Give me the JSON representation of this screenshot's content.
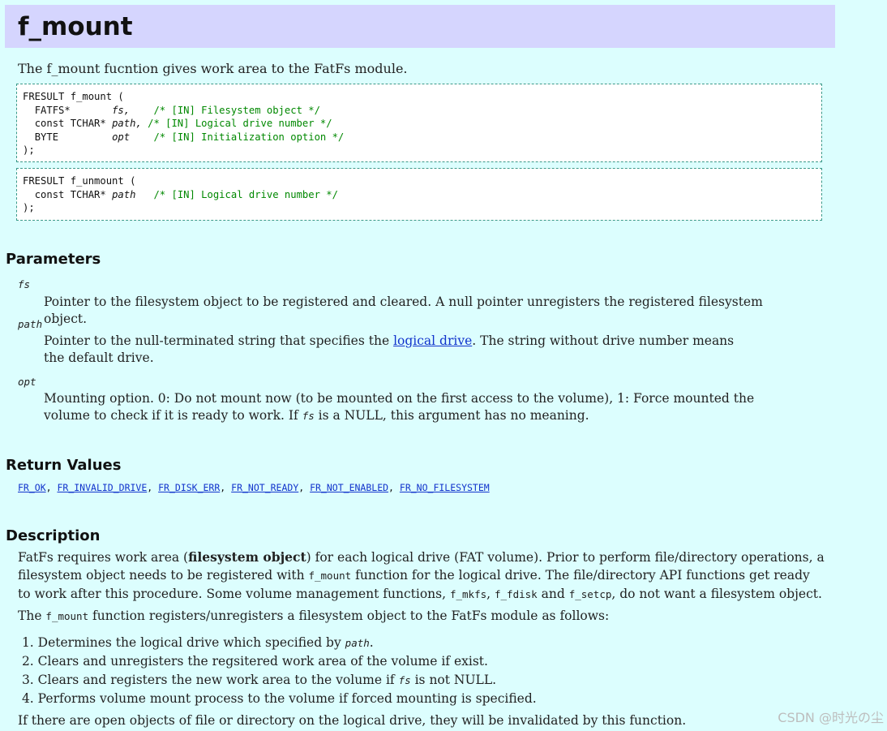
{
  "title": "f_mount",
  "abstract": "The f_mount fucntion gives work area to the FatFs module.",
  "prototype_mount": {
    "line1": "FRESULT f_mount (",
    "params": [
      {
        "type": "FATFS*      ",
        "name": "fs,   ",
        "comment": "/* [IN] Filesystem object */"
      },
      {
        "type": "const TCHAR*",
        "name": "path,",
        "comment": "/* [IN] Logical drive number */"
      },
      {
        "type": "BYTE        ",
        "name": "opt   ",
        "comment": "/* [IN] Initialization option */"
      }
    ],
    "close": ");"
  },
  "prototype_unmount": {
    "line1": "FRESULT f_unmount (",
    "params": [
      {
        "type": "const TCHAR*",
        "name": "path  ",
        "comment": "/* [IN] Logical drive number */"
      }
    ],
    "close": ");"
  },
  "parameters": {
    "heading": "Parameters",
    "fs": {
      "name": "fs",
      "desc": "Pointer to the filesystem object to be registered and cleared. A null pointer unregisters the registered filesystem object."
    },
    "path": {
      "name": "path",
      "desc_before": "Pointer to the null-terminated string that specifies the ",
      "link": "logical drive",
      "desc_after": ". The string without drive number means the default drive."
    },
    "opt": {
      "name": "opt",
      "desc_before": "Mounting option. 0: Do not mount now (to be mounted on the first access to the volume), 1: Force mounted the volume to check if it is ready to work. If ",
      "code": "fs",
      "desc_after": " is a NULL, this argument has no meaning."
    }
  },
  "return_values": {
    "heading": "Return Values",
    "items": [
      "FR_OK",
      "FR_INVALID_DRIVE",
      "FR_DISK_ERR",
      "FR_NOT_READY",
      "FR_NOT_ENABLED",
      "FR_NO_FILESYSTEM"
    ],
    "separator": ", "
  },
  "description": {
    "heading": "Description",
    "p1_a": "FatFs requires work area (",
    "p1_bold": "filesystem object",
    "p1_b": ") for each logical drive (FAT volume). Prior to perform file/directory operations, a filesystem object needs to be registered with ",
    "p1_code1": "f_mount",
    "p1_c": " function for the logical drive. The file/directory API functions get ready to work after this procedure. Some volume management functions, ",
    "p1_code2": "f_mkfs",
    "p1_d": ", ",
    "p1_code3": "f_fdisk",
    "p1_e": " and ",
    "p1_code4": "f_setcp",
    "p1_f": ", do not want a filesystem object.",
    "p2_a": "The ",
    "p2_code": "f_mount",
    "p2_b": " function registers/unregisters a filesystem object to the FatFs module as follows:",
    "steps": [
      {
        "num": "1.",
        "text_a": "Determines the logical drive which specified by ",
        "code": "path",
        "text_b": "."
      },
      {
        "num": "2.",
        "text_a": "Clears and unregisters the regsitered work area of the volume if exist.",
        "code": "",
        "text_b": ""
      },
      {
        "num": "3.",
        "text_a": "Clears and registers the new work area to the volume if ",
        "code": "fs",
        "text_b": " is not NULL."
      },
      {
        "num": "4.",
        "text_a": "Performs volume mount process to the volume if forced mounting is specified.",
        "code": "",
        "text_b": ""
      }
    ],
    "p3": "If there are open objects of file or directory on the logical drive, they will be invalidated by this function."
  },
  "watermark": "CSDN @时光の尘",
  "colors": {
    "background": "#dcfefe",
    "title_bar": "#d5d5fe",
    "comment": "#008800",
    "link": "#1133cc"
  }
}
